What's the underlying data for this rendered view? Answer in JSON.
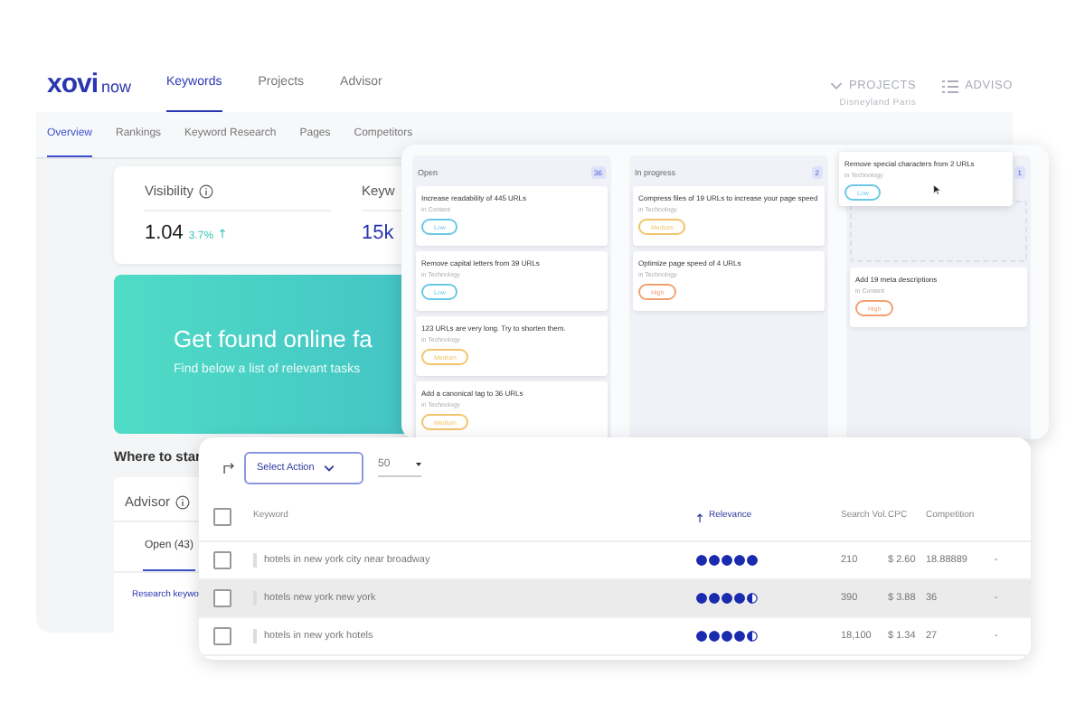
{
  "app": {
    "logo": {
      "brand": "xovi",
      "suffix": "now"
    },
    "nav": [
      {
        "label": "Keywords",
        "selected": true
      },
      {
        "label": "Projects",
        "selected": false
      },
      {
        "label": "Advisor",
        "selected": false
      }
    ],
    "projects": {
      "label": "PROJECTS",
      "subtitle": "Disneyland Paris"
    },
    "advisor_button": "ADVISO",
    "subnav": [
      {
        "label": "Overview",
        "selected": true
      },
      {
        "label": "Rankings",
        "selected": false
      },
      {
        "label": "Keyword Research",
        "selected": false
      },
      {
        "label": "Pages",
        "selected": false
      },
      {
        "label": "Competitors",
        "selected": false
      }
    ],
    "kpis": [
      {
        "label": "Visibility",
        "value": "1.04",
        "change": "3.7%"
      },
      {
        "label": "Keyw",
        "value": "15k"
      }
    ],
    "banner": {
      "title": "Get found online fa",
      "subtitle": "Find below a list of relevant tasks"
    },
    "section_title": "Where to star",
    "advisor": {
      "title": "Advisor",
      "tabs": [
        {
          "label": "Open (43)",
          "selected": true
        }
      ],
      "link": "Research keywo"
    }
  },
  "kanban": {
    "columns": [
      {
        "title": "Open",
        "count": "36",
        "drop_placeholder": false,
        "cards": [
          {
            "title": "Increase readability of 445 URLs",
            "category": "in Content",
            "priority": {
              "label": "Low",
              "color": "#6cc7e8"
            }
          },
          {
            "title": "Remove capital letters from 39 URLs",
            "category": "in Technology",
            "priority": {
              "label": "Low",
              "color": "#6cc7e8"
            }
          },
          {
            "title": "123 URLs are very long. Try to shorten them.",
            "category": "in Technology",
            "priority": {
              "label": "Medium",
              "color": "#f2c46b"
            }
          },
          {
            "title": "Add a canonical tag to 36 URLs",
            "category": "in Technology",
            "priority": {
              "label": "Medium",
              "color": "#f2c46b"
            }
          }
        ]
      },
      {
        "title": "In progress",
        "count": "2",
        "drop_placeholder": false,
        "cards": [
          {
            "title": "Compress files of 19 URLs to increase your page speed",
            "category": "in Technology",
            "priority": {
              "label": "Medium",
              "color": "#f2c46b"
            }
          },
          {
            "title": "Optimize page speed of 4 URLs",
            "category": "in Technology",
            "priority": {
              "label": "High",
              "color": "#f0a070"
            }
          }
        ]
      },
      {
        "count": "1",
        "drop_placeholder": true,
        "cards": [
          {
            "title": "Add 19 meta descriptions",
            "category": "in Content",
            "priority": {
              "label": "High",
              "color": "#f0a070"
            }
          }
        ]
      }
    ],
    "dragged_card": {
      "title": "Remove special characters from 2 URLs",
      "category": "in Technology",
      "priority": {
        "label": "Low",
        "color": "#6cc7e8"
      }
    }
  },
  "table": {
    "toolbar": {
      "action_button": "Select Action",
      "page_size": "50"
    },
    "all_checked": false,
    "columns": [
      {
        "label": "Keyword",
        "sorted": false
      },
      {
        "label": "Relevance",
        "sorted": true
      },
      {
        "label": "Search Vol.",
        "sorted": false
      },
      {
        "label": "CPC",
        "sorted": false
      },
      {
        "label": "Competition",
        "sorted": false
      }
    ],
    "rows": [
      {
        "checked": false,
        "highlighted": false,
        "keyword": "hotels in new york city near broadway",
        "stars": 5,
        "search_vol": "210",
        "cpc": "$ 2.60",
        "competition": "18.88889",
        "column_7": "-"
      },
      {
        "checked": false,
        "highlighted": true,
        "keyword": "hotels new york new york",
        "stars": 4.5,
        "search_vol": "390",
        "cpc": "$ 3.88",
        "competition": "36",
        "column_7": "-"
      },
      {
        "checked": false,
        "highlighted": false,
        "keyword": "hotels in new york hotels",
        "stars": 4.5,
        "search_vol": "18,100",
        "cpc": "$ 1.34",
        "competition": "27",
        "column_7": "-"
      }
    ]
  }
}
